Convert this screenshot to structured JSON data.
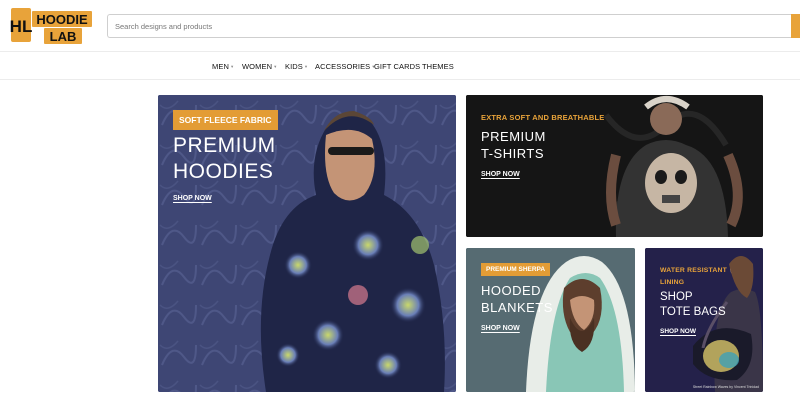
{
  "brand": {
    "logo_line1": "HOODIE",
    "logo_line2": "LAB",
    "logo_monogram": "HL"
  },
  "search": {
    "placeholder": "Search designs and products",
    "button_icon": "search-icon"
  },
  "nav": {
    "items": [
      {
        "label": "MEN",
        "has_dropdown": true
      },
      {
        "label": "WOMEN",
        "has_dropdown": true
      },
      {
        "label": "KIDS",
        "has_dropdown": true
      },
      {
        "label": "ACCESSORIES",
        "has_dropdown": true
      },
      {
        "label": "GIFT CARDS",
        "has_dropdown": false
      },
      {
        "label": "THEMES",
        "has_dropdown": false
      }
    ]
  },
  "banners": {
    "hoodies": {
      "tag": "SOFT FLEECE FABRIC",
      "title_line1": "PREMIUM",
      "title_line2": "HOODIES",
      "cta": "SHOP NOW"
    },
    "tshirts": {
      "eyebrow": "EXTRA SOFT AND BREATHABLE",
      "title_line1": "PREMIUM",
      "title_line2": "T-SHIRTS",
      "cta": "SHOP NOW"
    },
    "blankets": {
      "tag": "PREMIUM SHERPA",
      "title_line1": "HOODED",
      "title_line2": "BLANKETS",
      "cta": "SHOP NOW"
    },
    "totes": {
      "eyebrow_line1": "WATER RESISTANT",
      "eyebrow_line2": "LINING",
      "title_line1": "SHOP",
      "title_line2": "TOTE BAGS",
      "cta": "SHOP NOW",
      "credit": "Street Rainbow Waves by Vincent Trinidad"
    }
  },
  "colors": {
    "accent": "#e39c35",
    "hoodie_bg": "#3e4674",
    "tshirt_bg": "#151515",
    "blanket_bg": "#566b72",
    "tote_bg": "#24214a"
  }
}
